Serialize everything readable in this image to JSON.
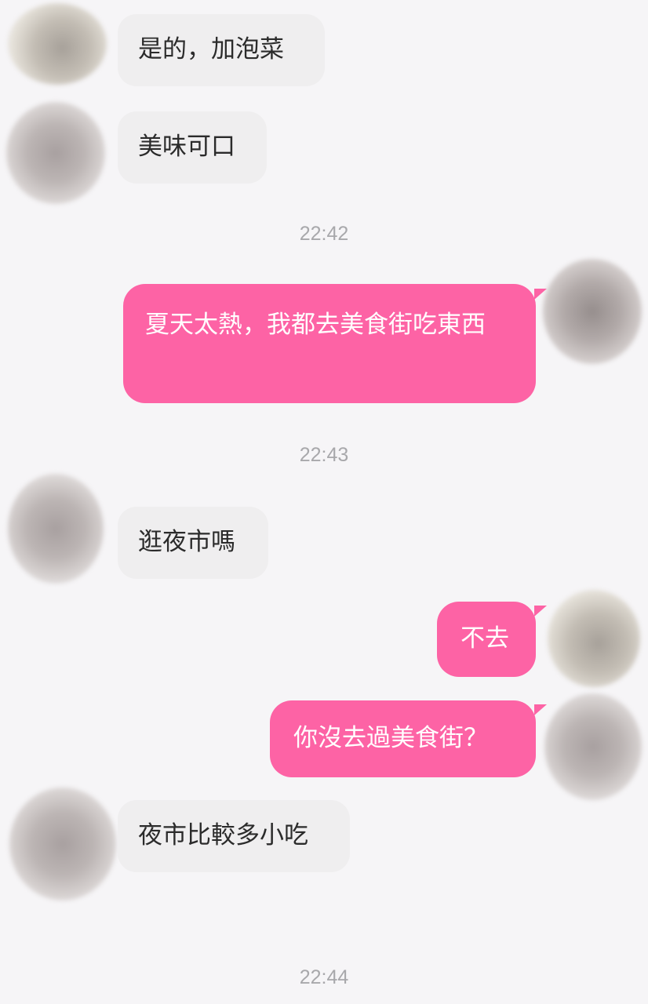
{
  "messages": [
    {
      "text": "是的，加泡菜"
    },
    {
      "text": "美味可口"
    },
    {
      "text": "夏天太熱，我都去美食街吃東西"
    },
    {
      "text": "逛夜市嗎"
    },
    {
      "text": "不去"
    },
    {
      "text": "你沒去過美食街？"
    },
    {
      "text": "夜市比較多小吃"
    }
  ],
  "timestamps": [
    "22:42",
    "22:43",
    "22:44"
  ],
  "colors": {
    "outgoing_bubble": "#fd63a5",
    "incoming_bubble": "#efeeef",
    "background": "#f6f5f7",
    "timestamp": "#a8a8ab"
  },
  "icons": [
    "avatar-blurred"
  ]
}
